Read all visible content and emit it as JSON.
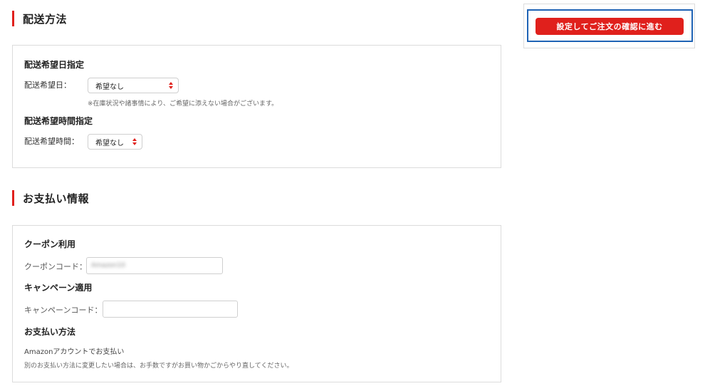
{
  "shipping": {
    "heading": "配送方法",
    "date_section_title": "配送希望日指定",
    "date_label": "配送希望日：",
    "date_select_value": "希望なし",
    "date_note": "※在庫状況や諸事情により、ご希望に添えない場合がございます。",
    "time_section_title": "配送希望時間指定",
    "time_label": "配送希望時間：",
    "time_select_value": "希望なし"
  },
  "payment": {
    "heading": "お支払い情報",
    "coupon_title": "クーポン利用",
    "coupon_label": "クーポンコード：",
    "coupon_value": "Amazon10",
    "campaign_title": "キャンペーン適用",
    "campaign_label": "キャンペーンコード：",
    "campaign_value": "",
    "method_title": "お支払い方法",
    "method_value": "Amazonアカウントでお支払い",
    "method_note": "別のお支払い方法に変更したい場合は、お手数ですがお買い物かごからやり直してください。"
  },
  "sidebar": {
    "confirm_button_label": "設定してご注文の確認に進む"
  },
  "colors": {
    "accent_red": "#e0201c",
    "highlight_blue": "#1f63b5",
    "border_gray": "#dcdcdc"
  }
}
